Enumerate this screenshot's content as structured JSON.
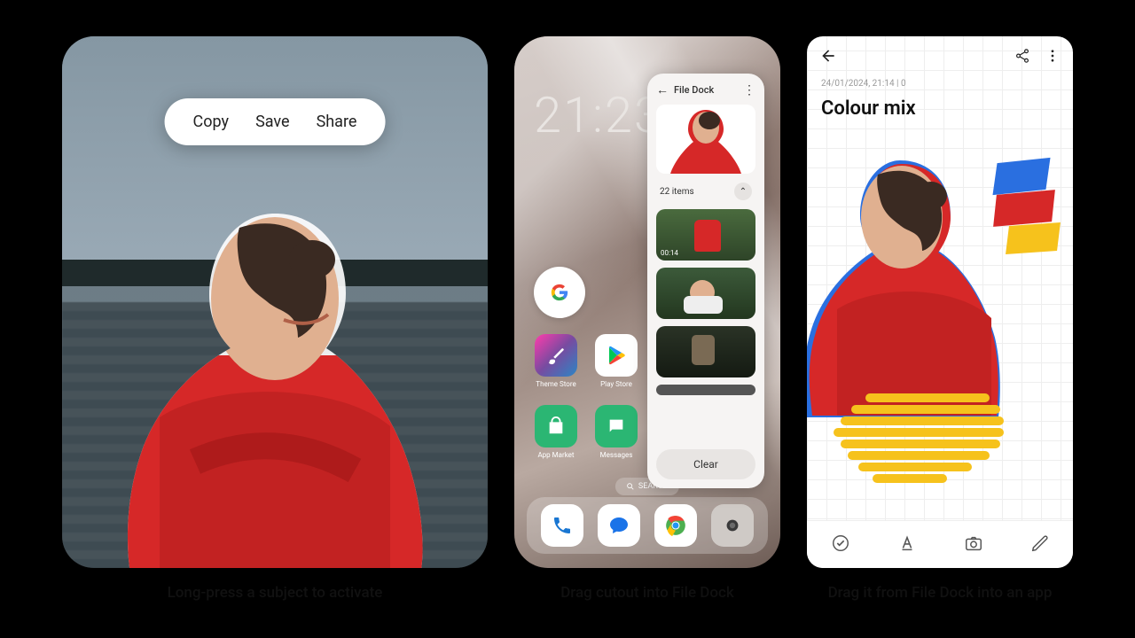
{
  "panel1": {
    "caption": "Long-press a subject to activate",
    "menu": {
      "copy": "Copy",
      "save": "Save",
      "share": "Share"
    }
  },
  "panel2": {
    "caption": "Drag cutout into File Dock",
    "clock": "21:23",
    "apps": {
      "theme_store": "Theme Store",
      "play_store": "Play Store",
      "app_market": "App Market",
      "messages": "Messages"
    },
    "search_label": "SEARCH",
    "filedock": {
      "title": "File Dock",
      "items_count": "22 items",
      "video_duration": "00:14",
      "clear": "Clear"
    }
  },
  "panel3": {
    "caption": "Drag it from File Dock into an app",
    "meta": "24/01/2024, 21:14  |  0",
    "title": "Colour mix"
  }
}
